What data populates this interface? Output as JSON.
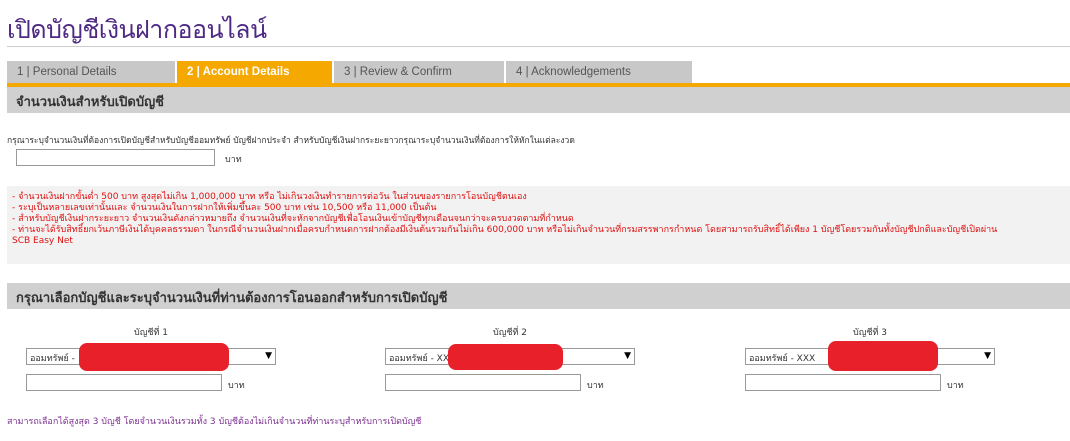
{
  "page_title": "เปิดบัญชีเงินฝากออนไลน์",
  "tabs": [
    {
      "label": "1 | Personal Details",
      "active": false
    },
    {
      "label": "2 | Account Details",
      "active": true
    },
    {
      "label": "3 | Review & Confirm",
      "active": false
    },
    {
      "label": "4 | Acknowledgements",
      "active": false
    }
  ],
  "section1": {
    "heading": "จำนวนเงินสำหรับเปิดบัญชี",
    "instruction": "กรุณาระบุจำนวนเงินที่ต้องการเปิดบัญชีสำหรับบัญชีออมทรัพย์ บัญชีฝากประจำ สำหรับบัญชีเงินฝากระยะยาวกรุณาระบุจำนวนเงินที่ต้องการให้หักในแต่ละงวด",
    "amount_value": "",
    "unit": "บาท",
    "notes": [
      "- จำนวนเงินฝากขั้นต่ำ 500 บาท สูงสุดไม่เกิน 1,000,000 บาท หรือ ไม่เกินวงเงินทำรายการต่อวัน ในส่วนของรายการโอนบัญชีตนเอง",
      "- ระบุเป็นหลายเลขเท่านั้นและ จำนวนเงินในการฝากให้เพิ่มขึ้นละ 500 บาท เช่น 10,500 หรือ 11,000 เป็นต้น",
      "- สำหรับบัญชีเงินฝากระยะยาว จำนวนเงินดังกล่าวหมายถึง จำนวนเงินที่จะหักจากบัญชีเพื่อโอนเงินเข้าบัญชีทุกเดือนจนกว่าจะครบงวดตามที่กำหนด",
      "- ท่านจะได้รับสิทธิ์ยกเว้นภาษีเงินได้บุคคลธรรมดา ในกรณีจำนวนเงินฝากเมื่อครบกำหนดการฝากต้องมีเงินต้นรวมกันไม่เกิน 600,000 บาท หรือไม่เกินจำนวนที่กรมสรรพากรกำหนด โดยสามารถรับสิทธิ์ได้เพียง 1 บัญชีโดยรวมกันทั้งบัญชีปกติและบัญชีเปิดผ่าน",
      "SCB Easy Net"
    ]
  },
  "section2": {
    "heading": "กรุณาเลือกบัญชีและระบุจำนวนเงินที่ท่านต้องการโอนออกสำหรับการเปิดบัญชี",
    "accounts": [
      {
        "title": "บัญชีที่ 1",
        "selected": "ออมทรัพย์ -",
        "amount": "",
        "unit": "บาท"
      },
      {
        "title": "บัญชีที่ 2",
        "selected": "ออมทรัพย์ - XX",
        "amount": "",
        "unit": "บาท"
      },
      {
        "title": "บัญชีที่ 3",
        "selected": "ออมทรัพย์ - XXX",
        "amount": "",
        "unit": "บาท"
      }
    ],
    "footer_note": "สามารถเลือกได้สูงสุด 3 บัญชี โดยจำนวนเงินรวมทั้ง 3 บัญชีต้องไม่เกินจำนวนที่ท่านระบุสำหรับการเปิดบัญชี"
  },
  "colors": {
    "title": "#4e2a84",
    "active_tab": "#f5a800",
    "notes_text": "#e01010",
    "redaction": "#e8202a",
    "footer_note": "#7b2f8f"
  },
  "icons": {
    "dropdown": "triangle-down"
  }
}
